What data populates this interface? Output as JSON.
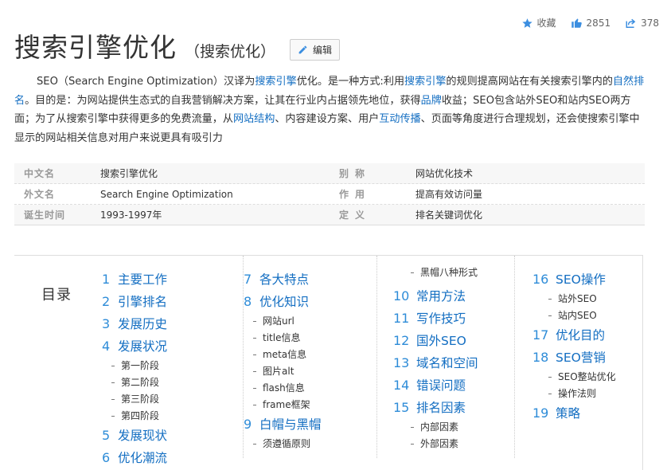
{
  "actions": {
    "favorite_label": "收藏",
    "like_count": "2851",
    "share_count": "378"
  },
  "title": {
    "main": "搜索引擎优化",
    "sub": "（搜索优化）",
    "edit_label": "编辑"
  },
  "summary": {
    "p1": "SEO（Search Engine Optimization）汉译为",
    "link1": "搜索引擎",
    "p2": "优化。是一种方式:利用",
    "link2": "搜索引擎",
    "p3": "的规则提高网站在有关搜索引擎内的",
    "link3": "自然排名",
    "p4": "。目的是：为网站提供生态式的自我营销解决方案，让其在行业内占据领先地位，获得",
    "link4": "品牌",
    "p5": "收益；SEO包含站外SEO和站内SEO两方面；为了从搜索引擎中获得更多的免费流量，从",
    "link5": "网站结构",
    "p6": "、内容建设方案、用户",
    "link6": "互动传播",
    "p7": "、页面等角度进行合理规划，还会使搜索引擎中显示的网站相关信息对用户来说更具有吸引力"
  },
  "info": [
    {
      "k1": "中文名",
      "v1": "搜索引擎优化",
      "k2": "别称",
      "v2": "网站优化技术"
    },
    {
      "k1": "外文名",
      "v1": "Search Engine Optimization",
      "k2": "作用",
      "v2": "提高有效访问量"
    },
    {
      "k1": "诞生时间",
      "v1": "1993-1997年",
      "k2": "定义",
      "v2": "排名关键词优化"
    }
  ],
  "catalog": {
    "label": "目录",
    "col1": {
      "i1": {
        "n": "1",
        "t": "主要工作"
      },
      "i2": {
        "n": "2",
        "t": "引擎排名"
      },
      "i3": {
        "n": "3",
        "t": "发展历史"
      },
      "i4": {
        "n": "4",
        "t": "发展状况"
      },
      "s4": [
        "第一阶段",
        "第二阶段",
        "第三阶段",
        "第四阶段"
      ],
      "i5": {
        "n": "5",
        "t": "发展现状"
      },
      "i6": {
        "n": "6",
        "t": "优化潮流"
      }
    },
    "col2": {
      "i7": {
        "n": "7",
        "t": "各大特点"
      },
      "i8": {
        "n": "8",
        "t": "优化知识"
      },
      "s8": [
        "网站url",
        "title信息",
        "meta信息",
        "图片alt",
        "flash信息",
        "frame框架"
      ],
      "i9": {
        "n": "9",
        "t": "白帽与黑帽"
      },
      "s9": [
        "须遵循原则"
      ]
    },
    "col3": {
      "s_top": [
        "黑帽八种形式"
      ],
      "i10": {
        "n": "10",
        "t": "常用方法"
      },
      "i11": {
        "n": "11",
        "t": "写作技巧"
      },
      "i12": {
        "n": "12",
        "t": "国外SEO"
      },
      "i13": {
        "n": "13",
        "t": "域名和空间"
      },
      "i14": {
        "n": "14",
        "t": "错误问题"
      },
      "i15": {
        "n": "15",
        "t": "排名因素"
      },
      "s15": [
        "内部因素",
        "外部因素"
      ]
    },
    "col4": {
      "i16": {
        "n": "16",
        "t": "SEO操作"
      },
      "s16": [
        "站外SEO",
        "站内SEO"
      ],
      "i17": {
        "n": "17",
        "t": "优化目的"
      },
      "i18": {
        "n": "18",
        "t": "SEO营销"
      },
      "s18": [
        "SEO整站优化",
        "操作法则"
      ],
      "i19": {
        "n": "19",
        "t": "策略"
      }
    }
  }
}
